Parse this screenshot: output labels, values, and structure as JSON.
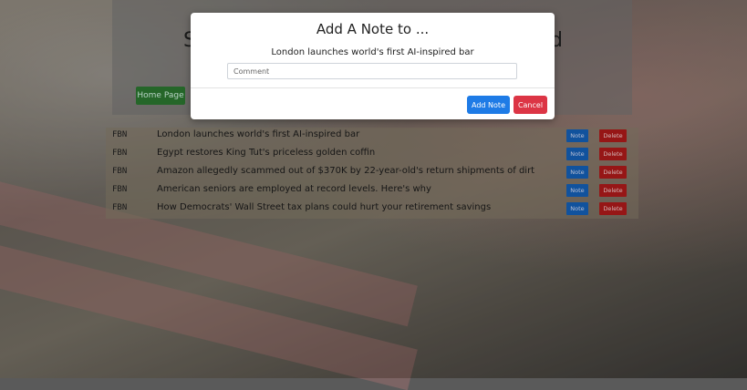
{
  "header": {
    "title_left_peek": "S",
    "title_right_peek": "d",
    "home_button_label": "Home Page"
  },
  "articles": [
    {
      "source": "FBN",
      "title": "London launches world's first AI-inspired bar",
      "note_label": "Note",
      "delete_label": "Delete"
    },
    {
      "source": "FBN",
      "title": "Egypt restores King Tut's priceless golden coffin",
      "note_label": "Note",
      "delete_label": "Delete"
    },
    {
      "source": "FBN",
      "title": "Amazon allegedly scammed out of $370K by 22-year-old's return shipments of dirt",
      "note_label": "Note",
      "delete_label": "Delete"
    },
    {
      "source": "FBN",
      "title": "American seniors are employed at record levels. Here's why",
      "note_label": "Note",
      "delete_label": "Delete"
    },
    {
      "source": "FBN",
      "title": "How Democrats' Wall Street tax plans could hurt your retirement savings",
      "note_label": "Note",
      "delete_label": "Delete"
    }
  ],
  "modal": {
    "title": "Add A Note to ...",
    "article_title": "London launches world's first AI-inspired bar",
    "comment_placeholder": "Comment",
    "comment_value": "",
    "add_note_label": "Add Note",
    "cancel_label": "Cancel"
  },
  "colors": {
    "primary": "#1e7be6",
    "danger": "#dc3545",
    "success": "#2e7d32"
  }
}
